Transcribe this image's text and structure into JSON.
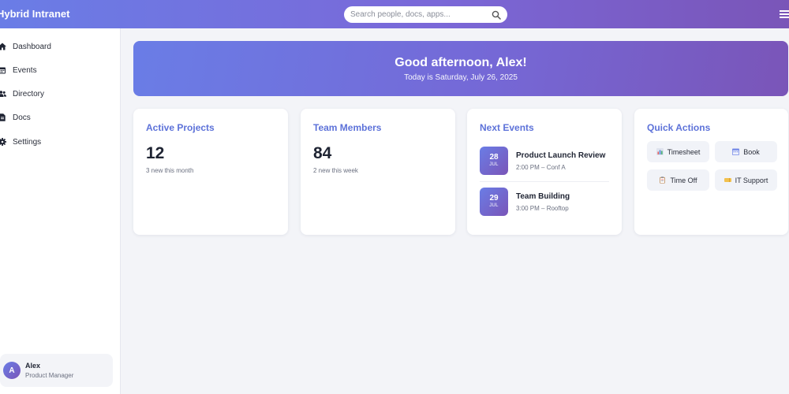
{
  "header": {
    "brand": "Hybrid Intranet",
    "search_placeholder": "Search people, docs, apps...",
    "search_icon": "search-icon",
    "menu_icon": "hamburger-menu-icon"
  },
  "sidebar": {
    "items": [
      {
        "label": "Dashboard",
        "icon": "home-icon"
      },
      {
        "label": "Events",
        "icon": "calendar-icon"
      },
      {
        "label": "Directory",
        "icon": "users-icon"
      },
      {
        "label": "Docs",
        "icon": "document-icon"
      },
      {
        "label": "Settings",
        "icon": "gear-icon"
      }
    ],
    "user": {
      "initial": "A",
      "name": "Alex",
      "role": "Product Manager"
    }
  },
  "banner": {
    "title": "Good afternoon, Alex!",
    "subtitle": "Today is Saturday, July 26, 2025"
  },
  "cards": {
    "projects": {
      "title": "Active Projects",
      "value": "12",
      "note": "3 new this month"
    },
    "members": {
      "title": "Team Members",
      "value": "84",
      "note": "2 new this week"
    },
    "events": {
      "title": "Next Events",
      "items": [
        {
          "day": "28",
          "month": "JUL",
          "title": "Product Launch Review",
          "meta": "2:00 PM – Conf A"
        },
        {
          "day": "29",
          "month": "JUL",
          "title": "Team Building",
          "meta": "3:00 PM – Rooftop"
        }
      ]
    },
    "quick_actions": {
      "title": "Quick Actions",
      "items": [
        {
          "label": "Timesheet",
          "icon": "chart-icon"
        },
        {
          "label": "Book",
          "icon": "calendar-icon"
        },
        {
          "label": "Time Off",
          "icon": "clipboard-icon"
        },
        {
          "label": "IT Support",
          "icon": "ticket-icon"
        }
      ]
    }
  },
  "colors": {
    "accent": "#5d72d9",
    "gradient_start": "#6a7de6",
    "gradient_end": "#7a55b8",
    "background": "#f3f4f8"
  }
}
